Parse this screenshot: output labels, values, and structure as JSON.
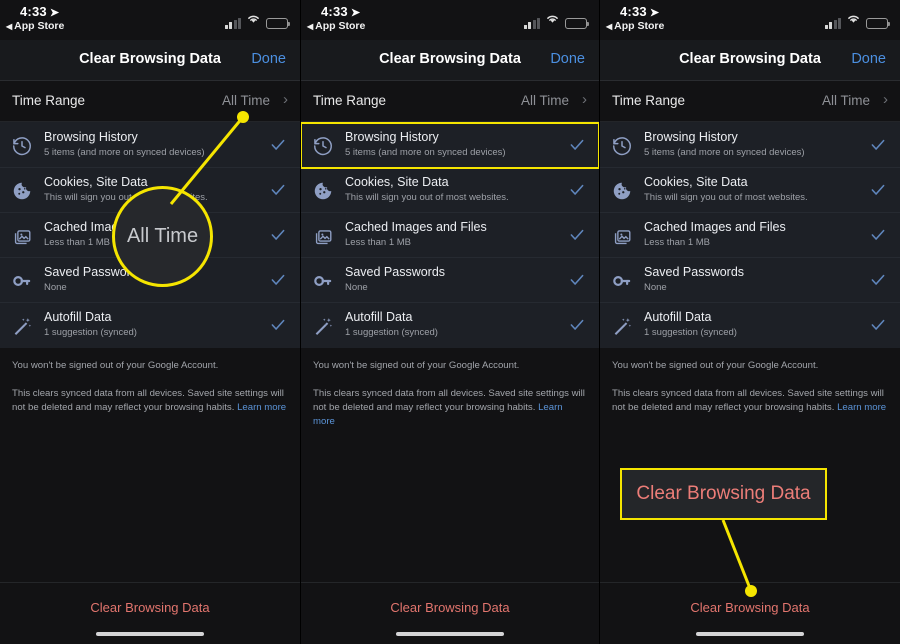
{
  "status_bar": {
    "time": "4:33",
    "location_icon": "location-arrow-icon",
    "back_app": "App Store",
    "back_triangle": "◀",
    "signal_icon": "cellular-signal-icon",
    "wifi_icon": "wifi-icon",
    "battery_icon": "battery-low-icon"
  },
  "nav": {
    "title": "Clear Browsing Data",
    "done_label": "Done"
  },
  "time_range": {
    "label": "Time Range",
    "value": "All Time",
    "chevron": "›"
  },
  "rows": [
    {
      "icon": "history-clock-icon",
      "title": "Browsing History",
      "subtitle": "5 items (and more on synced devices)",
      "checked": true
    },
    {
      "icon": "cookie-icon",
      "title": "Cookies, Site Data",
      "subtitle": "This will sign you out of most websites.",
      "checked": true
    },
    {
      "icon": "cached-images-icon",
      "title": "Cached Images and Files",
      "subtitle": "Less than 1 MB",
      "checked": true
    },
    {
      "icon": "key-icon",
      "title": "Saved Passwords",
      "subtitle": "None",
      "checked": true
    },
    {
      "icon": "magic-wand-icon",
      "title": "Autofill Data",
      "subtitle": "1 suggestion (synced)",
      "checked": true
    }
  ],
  "footer": {
    "line1": "You won't be signed out of your Google Account.",
    "line2": "This clears synced data from all devices. Saved site settings will not be deleted and may reflect your browsing habits. ",
    "learn_more": "Learn more"
  },
  "bottom": {
    "clear_label": "Clear Browsing Data",
    "home_indicator": "home-indicator"
  },
  "annotations": {
    "panel1_magnifier_text": "All Time",
    "panel3_callout_text": "Clear Browsing Data",
    "highlight_color": "#f5e500",
    "callout_text_color": "#ec7d78"
  },
  "colors": {
    "page_bg": "#121214",
    "list_bg": "#1d2026",
    "nav_bg": "#181a1d",
    "accent_blue": "#4b8fe0",
    "check_blue": "#5f86bd",
    "danger_red": "#e2756e",
    "annotation_yellow": "#f5e500",
    "battery_yellow": "#f5c518"
  }
}
